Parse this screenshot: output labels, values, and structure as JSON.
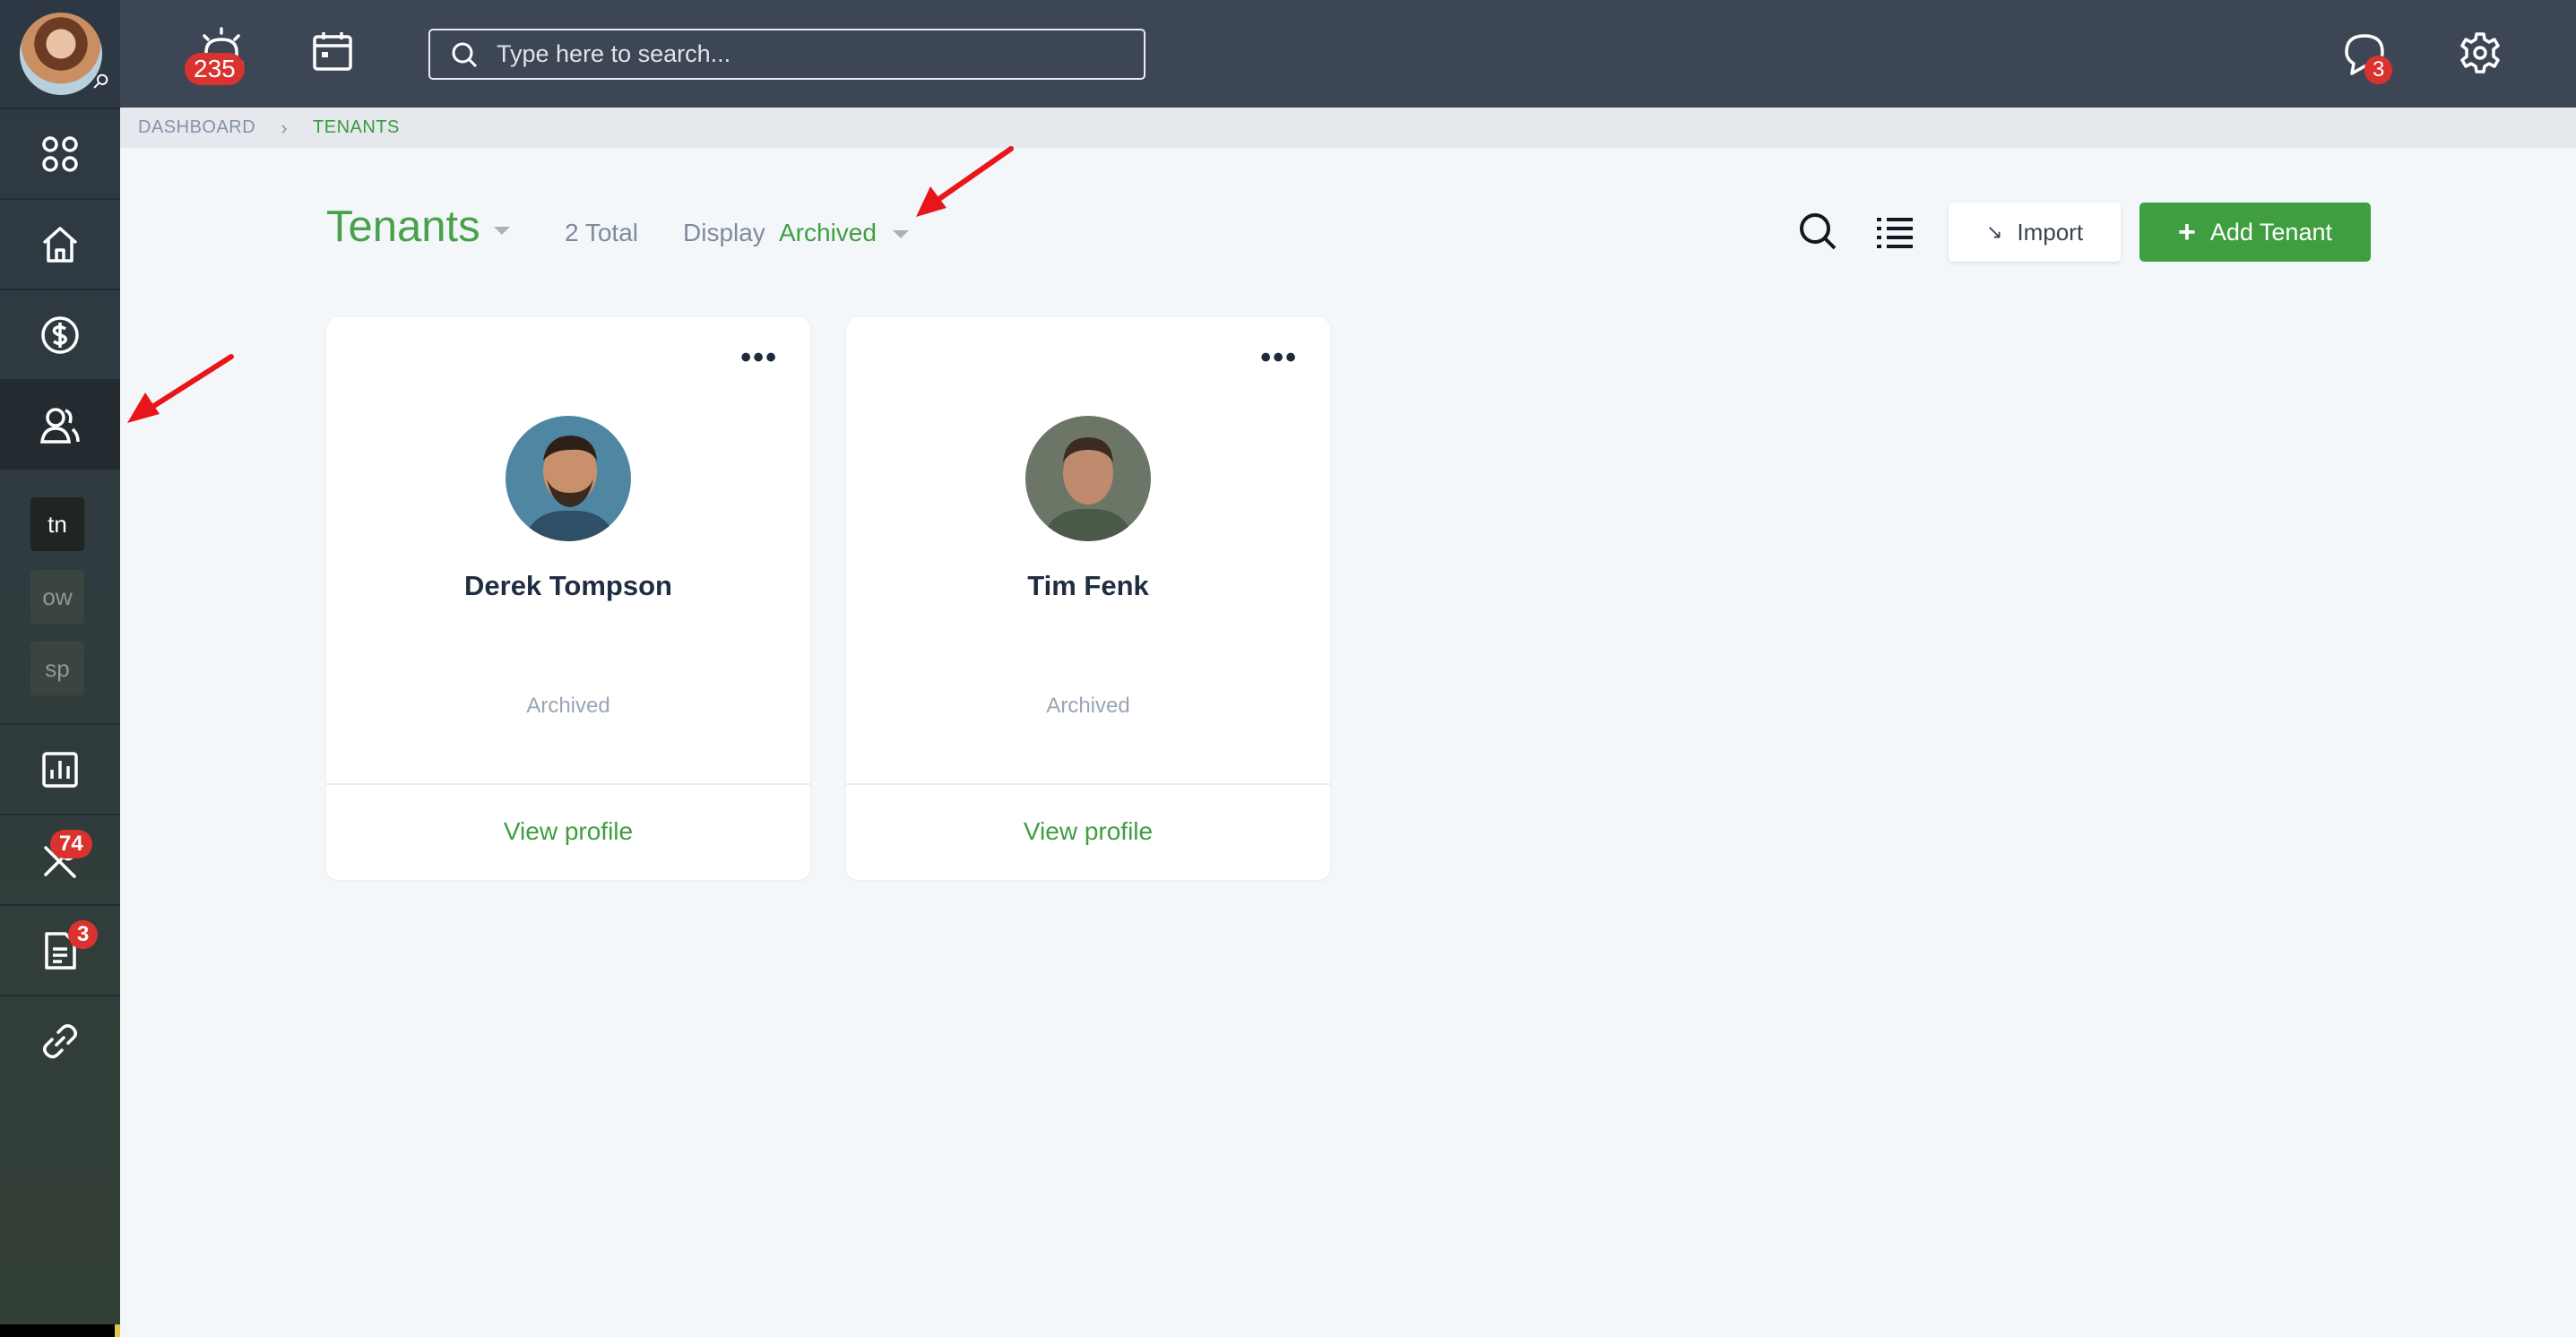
{
  "topbar": {
    "notification_count": "235",
    "search_placeholder": "Type here to search...",
    "messages_count": "3"
  },
  "sidebar": {
    "items": [
      {
        "name": "apps",
        "icon": "grid-icon"
      },
      {
        "name": "home",
        "icon": "home-icon"
      },
      {
        "name": "payments",
        "icon": "dollar-icon"
      },
      {
        "name": "tenants",
        "icon": "users-icon",
        "active": true
      },
      {
        "name": "reports",
        "icon": "chart-icon"
      },
      {
        "name": "maintenance",
        "icon": "tools-icon",
        "badge": "74"
      },
      {
        "name": "documents",
        "icon": "document-icon",
        "badge": "3"
      },
      {
        "name": "links",
        "icon": "link-icon"
      }
    ],
    "subitems": [
      "tn",
      "ow",
      "sp"
    ]
  },
  "breadcrumb": {
    "dashboard": "DASHBOARD",
    "current": "TENANTS"
  },
  "header": {
    "title": "Tenants",
    "total": "2 Total",
    "display_label": "Display",
    "display_value": "Archived",
    "import_label": "Import",
    "add_label": "Add Tenant"
  },
  "tenants": [
    {
      "name": "Derek Tompson",
      "status": "Archived",
      "action": "View profile"
    },
    {
      "name": "Tim Fenk",
      "status": "Archived",
      "action": "View profile"
    }
  ],
  "colors": {
    "accent_green": "#3f9e40",
    "badge_red": "#d9322f",
    "topbar": "#3d4654",
    "annotation_arrow": "#e8151b"
  }
}
